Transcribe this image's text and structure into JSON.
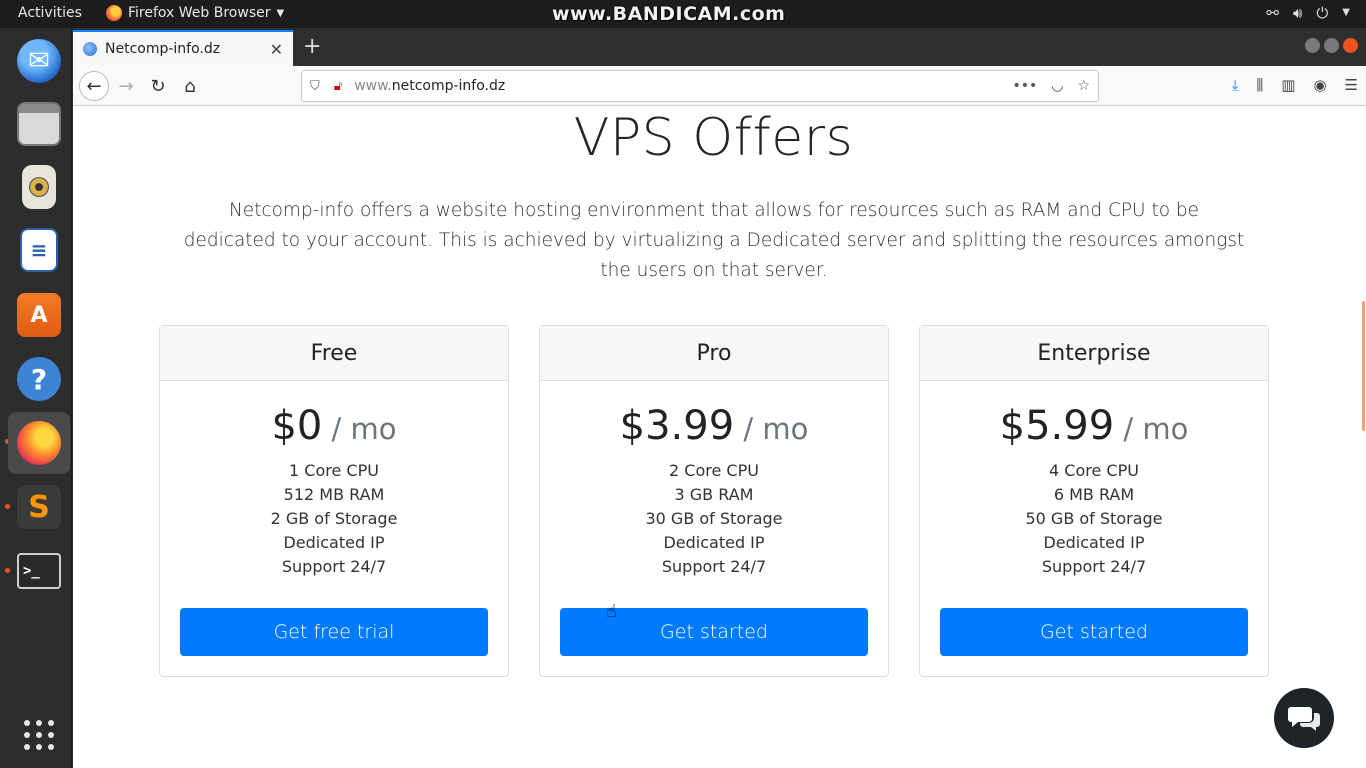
{
  "topbar": {
    "activities": "Activities",
    "app_name": "Firefox Web Browser",
    "watermark": "www.BANDICAM.com"
  },
  "dock": {
    "items": [
      "thunderbird",
      "files",
      "rhythmbox",
      "libreoffice-writer",
      "ubuntu-software",
      "help",
      "firefox",
      "sublime-text",
      "terminal",
      "show-applications"
    ]
  },
  "browser": {
    "tab_title": "Netcomp-info.dz",
    "url_prefix": "www.",
    "url_domain": "netcomp-info.dz",
    "page_actions": "•••"
  },
  "page": {
    "title": "VPS Offers",
    "lead": "Netcomp-info offers a website hosting environment that allows for resources such as RAM and CPU to be dedicated to your account. This is achieved by virtualizing a Dedicated server and splitting the resources amongst the users on that server.",
    "plans": [
      {
        "name": "Free",
        "price": "$0",
        "period": " / mo",
        "features": [
          "1 Core CPU",
          "512 MB RAM",
          "2 GB of Storage",
          "Dedicated IP",
          "Support 24/7"
        ],
        "button": "Get free trial"
      },
      {
        "name": "Pro",
        "price": "$3.99",
        "period": " / mo",
        "features": [
          "2 Core CPU",
          "3 GB RAM",
          "30 GB of Storage",
          "Dedicated IP",
          "Support 24/7"
        ],
        "button": "Get started"
      },
      {
        "name": "Enterprise",
        "price": "$5.99",
        "period": " / mo",
        "features": [
          "4 Core CPU",
          "6 MB RAM",
          "50 GB of Storage",
          "Dedicated IP",
          "Support 24/7"
        ],
        "button": "Get started"
      }
    ]
  },
  "colors": {
    "primary_button": "#007bff",
    "ubuntu_orange": "#e95420",
    "firefox_blue": "#0a84ff"
  }
}
